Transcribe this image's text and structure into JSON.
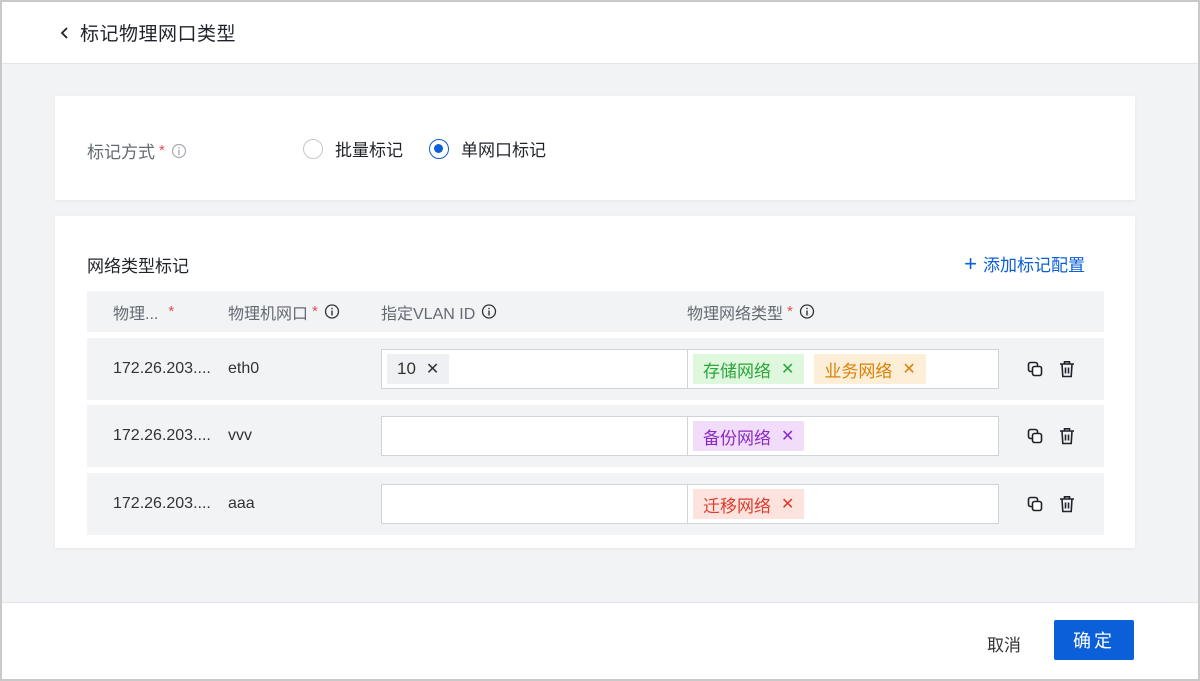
{
  "header": {
    "title": "标记物理网口类型"
  },
  "mode": {
    "label": "标记方式",
    "required_mark": "*",
    "options": [
      {
        "label": "批量标记",
        "checked": false
      },
      {
        "label": "单网口标记",
        "checked": true
      }
    ]
  },
  "section": {
    "title": "网络类型标记",
    "add_label": "添加标记配置"
  },
  "table": {
    "headers": [
      {
        "label": "物理...",
        "required": "*"
      },
      {
        "label": "物理机网口",
        "required": "*"
      },
      {
        "label": "指定VLAN ID"
      },
      {
        "label": "物理网络类型",
        "required": "*"
      }
    ],
    "rows": [
      {
        "host": "172.26.203....",
        "port": "eth0",
        "vlan": [
          "10"
        ],
        "networks": [
          {
            "label": "存储网络",
            "color": "green"
          },
          {
            "label": "业务网络",
            "color": "orange"
          }
        ]
      },
      {
        "host": "172.26.203....",
        "port": "vvv",
        "vlan": [],
        "networks": [
          {
            "label": "备份网络",
            "color": "purple"
          }
        ]
      },
      {
        "host": "172.26.203....",
        "port": "aaa",
        "vlan": [],
        "networks": [
          {
            "label": "迁移网络",
            "color": "red"
          }
        ]
      }
    ]
  },
  "footer": {
    "cancel_label": "取消",
    "ok_label": "确定"
  },
  "colors": {
    "primary": "#0b5fd8",
    "required": "#e34d59"
  }
}
